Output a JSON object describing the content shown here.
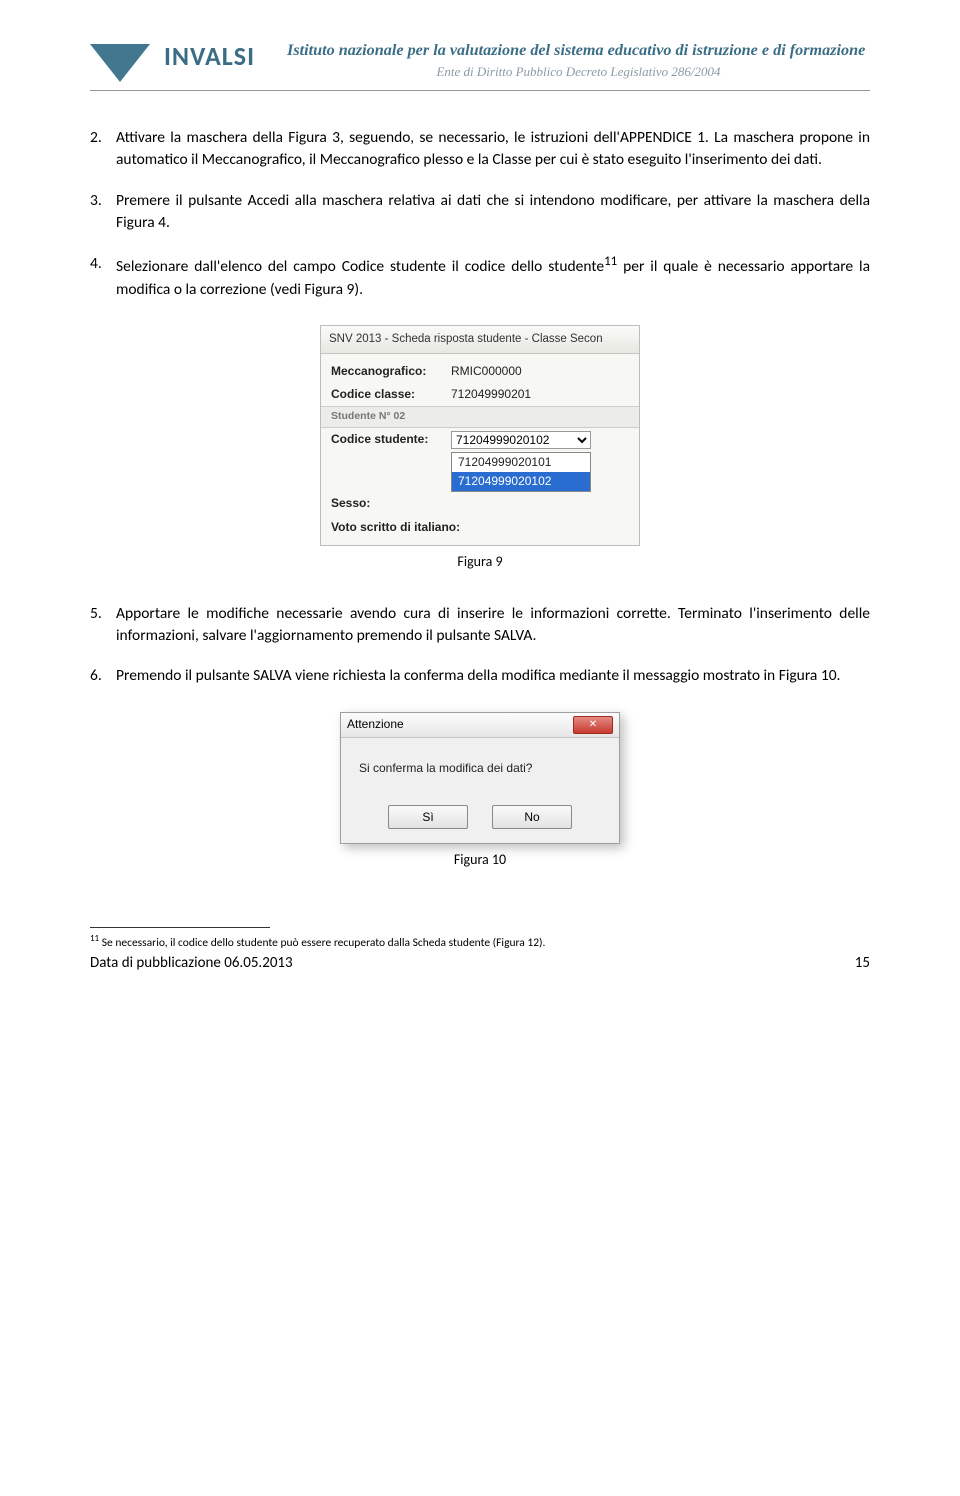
{
  "header": {
    "logo": "INVALSI",
    "institution": "Istituto nazionale per la valutazione del sistema educativo di istruzione e di formazione",
    "subtitle": "Ente di Diritto Pubblico Decreto Legislativo 286/2004"
  },
  "items": {
    "i2": "Attivare la maschera della Figura 3, seguendo, se necessario, le istruzioni dell'APPENDICE 1. La maschera propone in automatico il Meccanografico, il Meccanografico plesso e la Classe per cui è stato eseguito l'inserimento dei dati.",
    "i3": "Premere il pulsante Accedi alla maschera relativa ai dati che si intendono modificare, per attivare la maschera della Figura 4.",
    "i4a": "Selezionare dall'elenco del campo Codice studente il codice dello studente",
    "i4b": " per il quale è necessario apportare la modifica o la correzione (vedi Figura 9).",
    "i5": "Apportare le modifiche necessarie avendo cura di inserire le informazioni corrette. Terminato l'inserimento delle informazioni, salvare l'aggiornamento premendo il pulsante SALVA.",
    "i6": "Premendo il pulsante SALVA viene richiesta la conferma della modifica mediante il messaggio mostrato in Figura 10."
  },
  "fig9": {
    "title": "SNV 2013 - Scheda risposta studente - Classe Secon",
    "mecc_label": "Meccanografico:",
    "mecc_val": "RMIC000000",
    "classe_label": "Codice classe:",
    "classe_val": "712049990201",
    "group": "Studente N° 02",
    "codstud_label": "Codice studente:",
    "codstud_val": "71204999020102",
    "opt1": "71204999020101",
    "opt2": "71204999020102",
    "sesso_label": "Sesso:",
    "voto_label": "Voto scritto di italiano:",
    "caption": "Figura 9"
  },
  "fig10": {
    "title": "Attenzione",
    "close": "✕",
    "msg": "Si conferma la modifica dei dati?",
    "yes": "Sì",
    "no": "No",
    "caption": "Figura 10"
  },
  "footnote": {
    "num": "11",
    "text": " Se necessario, il codice dello studente può essere recuperato dalla Scheda studente (Figura 12)."
  },
  "footer": {
    "pubdate": "Data di pubblicazione 06.05.2013",
    "page": "15"
  }
}
